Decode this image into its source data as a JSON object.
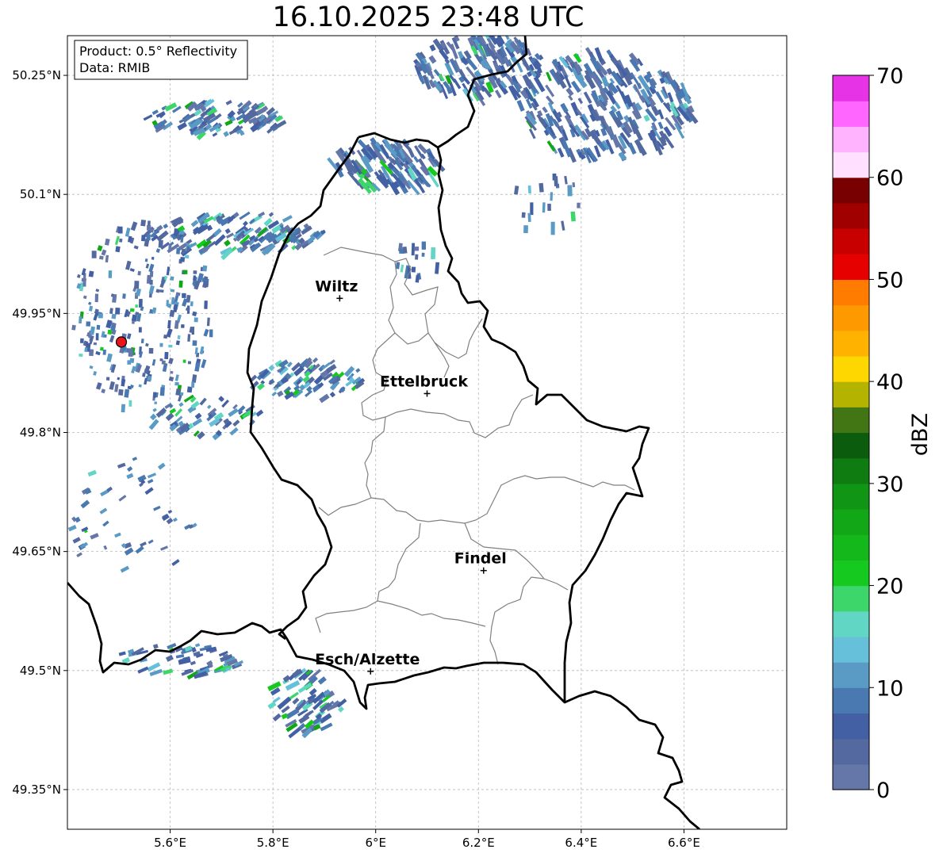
{
  "title": "16.10.2025 23:48 UTC",
  "info": {
    "product": "Product: 0.5° Reflectivity",
    "data": "Data: RMIB"
  },
  "map": {
    "lon_range": [
      5.4,
      6.8
    ],
    "lat_range": [
      49.3,
      50.3
    ],
    "lon_ticks": [
      5.6,
      5.8,
      6.0,
      6.2,
      6.4,
      6.6
    ],
    "lon_tick_labels": [
      "5.6°E",
      "5.8°E",
      "6°E",
      "6.2°E",
      "6.4°E",
      "6.6°E"
    ],
    "lat_ticks": [
      50.25,
      50.1,
      49.95,
      49.8,
      49.65,
      49.5,
      49.35
    ],
    "lat_tick_labels": [
      "50.25°N",
      "50.1°N",
      "49.95°N",
      "49.8°N",
      "49.65°N",
      "49.5°N",
      "49.35°N"
    ],
    "gridlines": true
  },
  "cities": [
    {
      "name": "Wiltz",
      "lon": 5.93,
      "lat": 49.969
    },
    {
      "name": "Ettelbruck",
      "lon": 6.1,
      "lat": 49.849
    },
    {
      "name": "Findel",
      "lon": 6.21,
      "lat": 49.626
    },
    {
      "name": "Esch/Alzette",
      "lon": 5.99,
      "lat": 49.499
    }
  ],
  "radar_site": {
    "lon": 5.505,
    "lat": 49.914,
    "color": "#e8141a"
  },
  "colorbar": {
    "label": "dBZ",
    "min": 0,
    "max": 70,
    "ticks": [
      0,
      10,
      20,
      30,
      40,
      50,
      60,
      70
    ],
    "colors": [
      "#6577a8",
      "#53699f",
      "#4260a3",
      "#4a78b0",
      "#5a9bc6",
      "#66c0d9",
      "#62d6c4",
      "#3cd66b",
      "#16c91f",
      "#14b81b",
      "#12a716",
      "#109614",
      "#0e7c11",
      "#0b5c0c",
      "#427614",
      "#b3b300",
      "#ffd700",
      "#ffb300",
      "#ff9900",
      "#ff7c00",
      "#e60000",
      "#c80000",
      "#a00000",
      "#780000",
      "#ffe0ff",
      "#ffb3ff",
      "#ff66ff",
      "#e633e6"
    ]
  }
}
